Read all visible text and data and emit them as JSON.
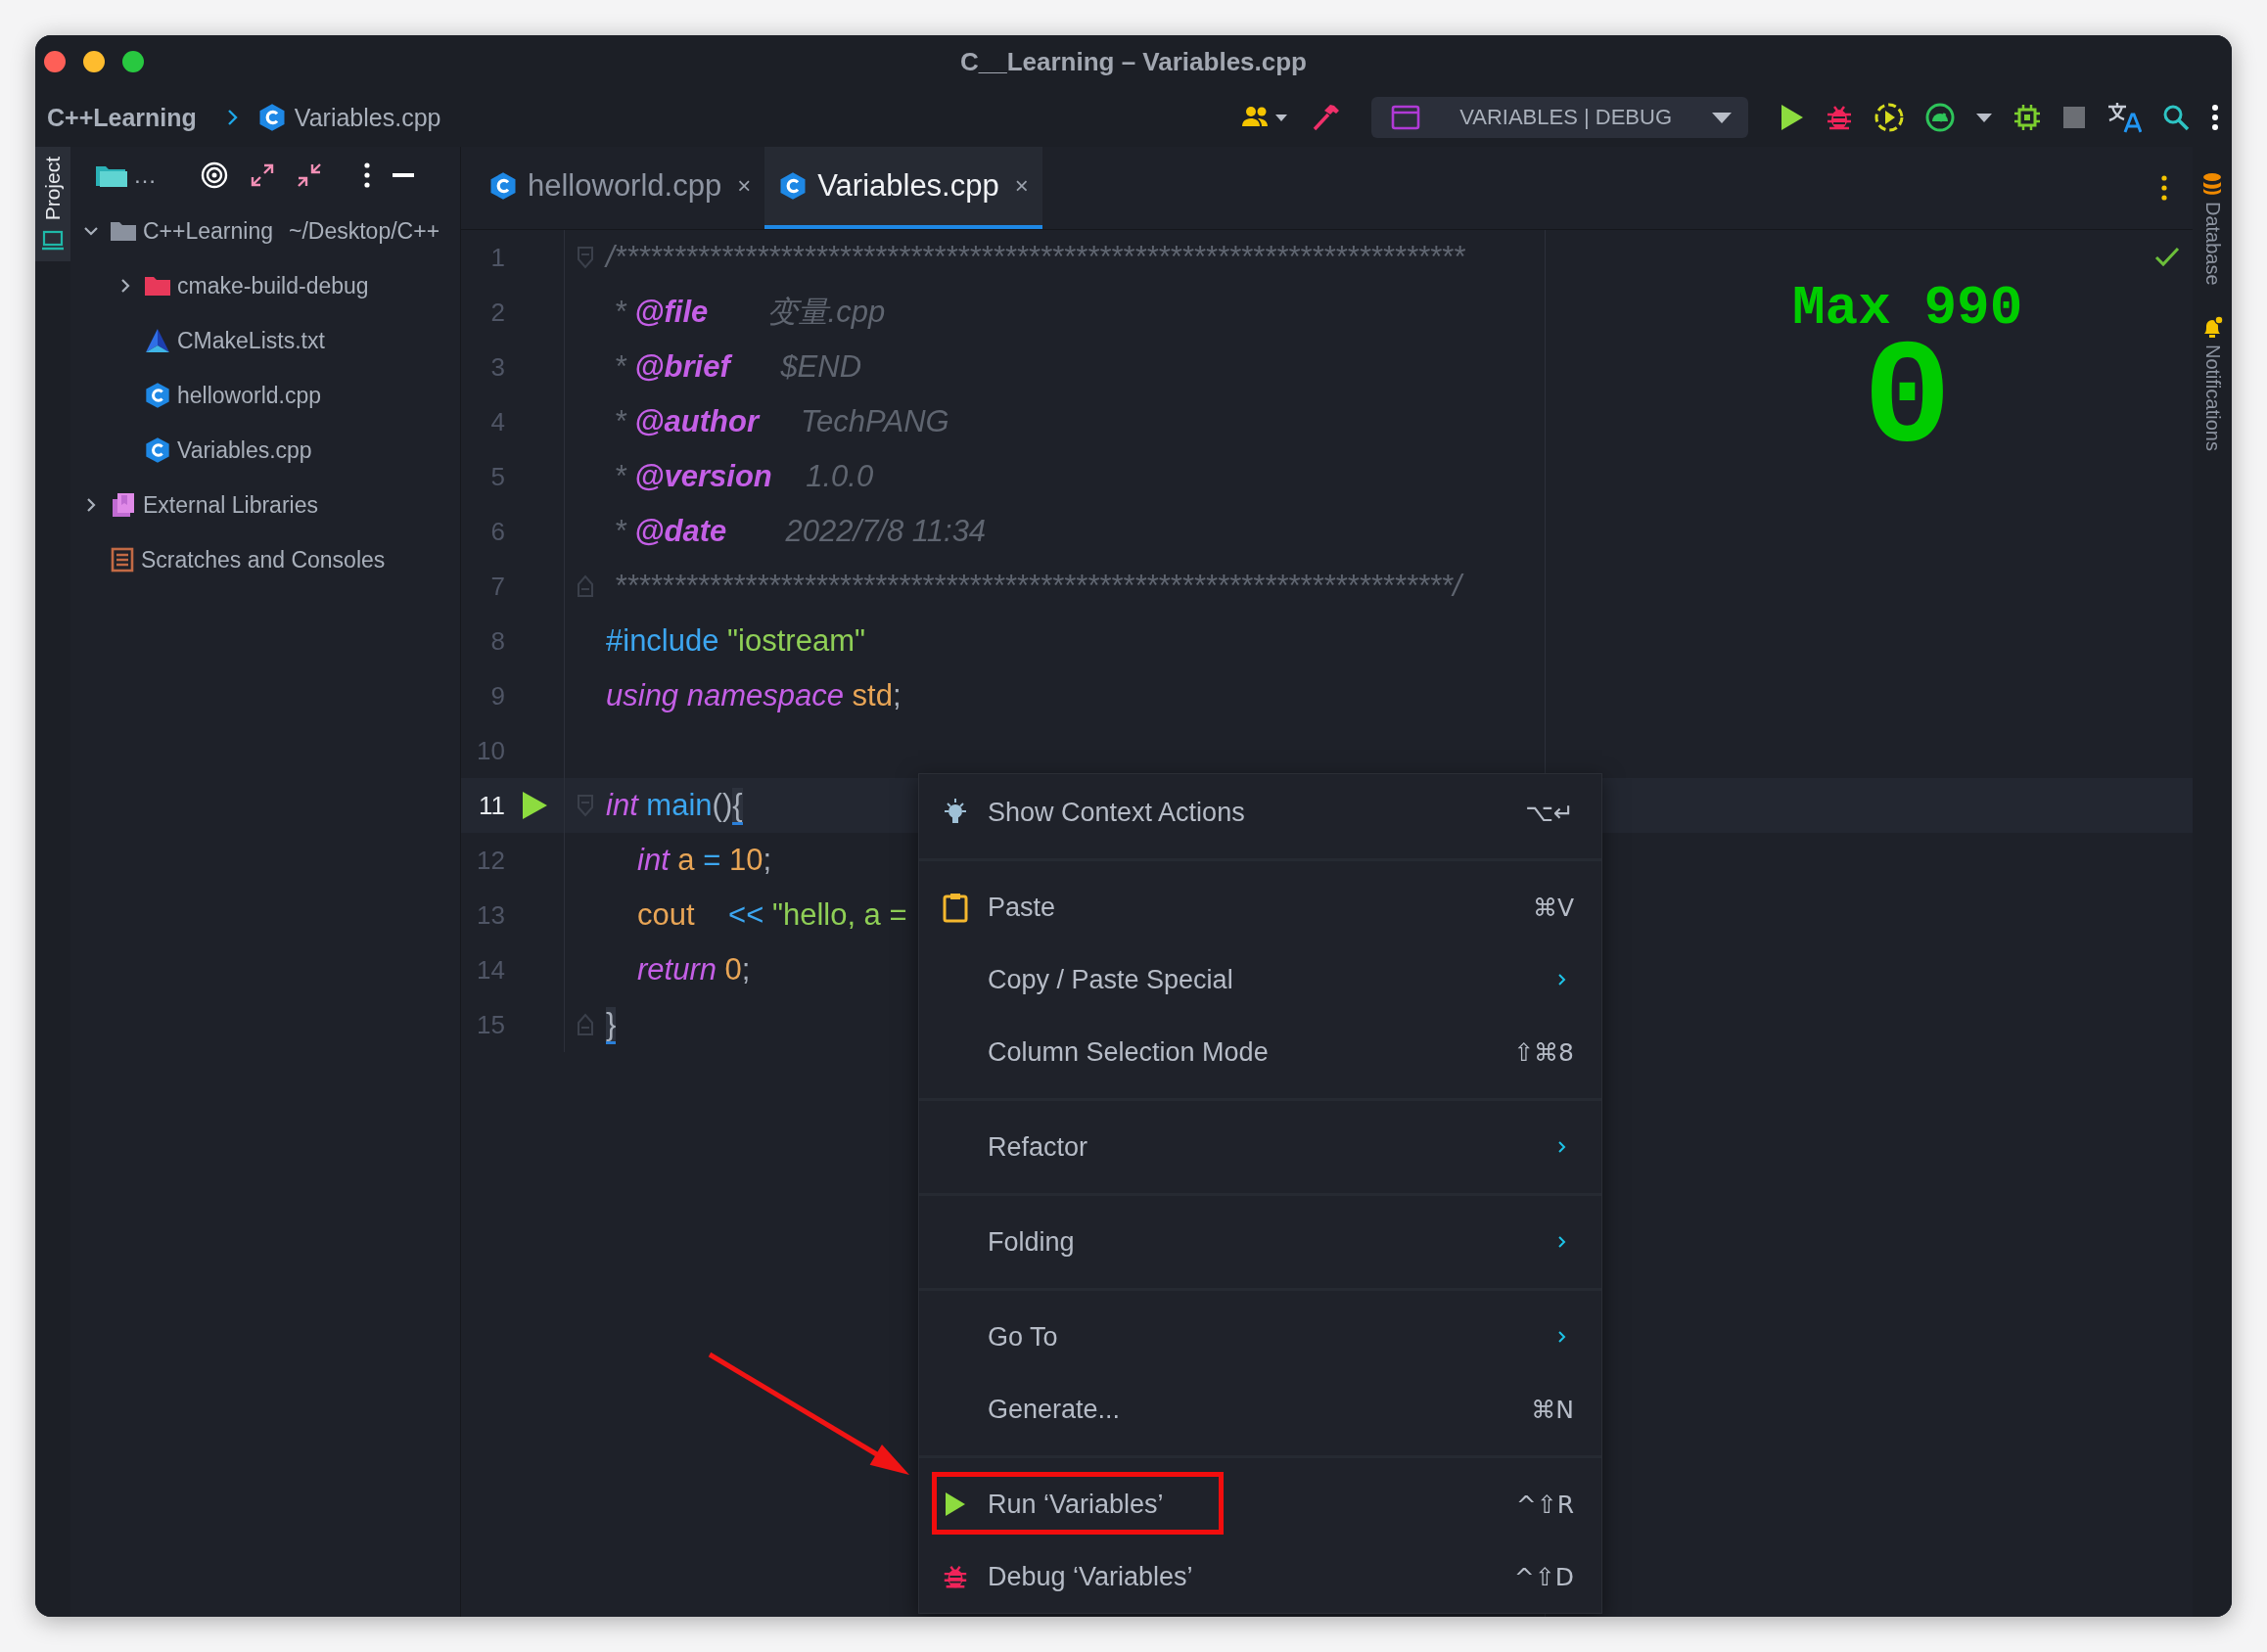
{
  "window": {
    "title": "C__Learning – Variables.cpp"
  },
  "navbar": {
    "breadcrumb": [
      {
        "label": "C++Learning",
        "kind": "project"
      },
      {
        "label": "Variables.cpp",
        "kind": "file"
      }
    ],
    "run_config": "VARIABLES | DEBUG"
  },
  "tool_windows": {
    "left": [
      {
        "label": "Project",
        "selected": true
      }
    ],
    "right": [
      {
        "label": "Database",
        "kind": "database"
      },
      {
        "label": "Notifications",
        "kind": "notifications"
      }
    ]
  },
  "project_panel": {
    "title": "…",
    "tree": [
      {
        "label": "C++Learning",
        "path": "~/Desktop/C++",
        "kind": "project-folder",
        "expanded": true,
        "children": [
          {
            "label": "cmake-build-debug",
            "kind": "excluded-folder",
            "expanded": false
          },
          {
            "label": "CMakeLists.txt",
            "kind": "cmake"
          },
          {
            "label": "helloworld.cpp",
            "kind": "cpp"
          },
          {
            "label": "Variables.cpp",
            "kind": "cpp"
          }
        ]
      },
      {
        "label": "External Libraries",
        "kind": "libraries",
        "expanded": false
      },
      {
        "label": "Scratches and Consoles",
        "kind": "scratches"
      }
    ]
  },
  "editor": {
    "tabs": [
      {
        "label": "helloworld.cpp",
        "close": "×",
        "selected": false
      },
      {
        "label": "Variables.cpp",
        "close": "×",
        "selected": true
      }
    ],
    "lines": [
      {
        "number": "1",
        "kind": "fold_start",
        "current": false,
        "run_marker": false,
        "indented": false,
        "tokens": [
          {
            "text": "/************************************************************************",
            "kind": "comment"
          }
        ]
      },
      {
        "number": "2",
        "kind": "plain",
        "current": false,
        "run_marker": false,
        "indented": false,
        "tokens": [
          {
            "text": " * ",
            "kind": "comment"
          },
          {
            "text": "@file",
            "kind": "tag"
          },
          {
            "text": "       变量.cpp",
            "kind": "doc"
          }
        ]
      },
      {
        "number": "3",
        "kind": "plain",
        "current": false,
        "run_marker": false,
        "indented": false,
        "tokens": [
          {
            "text": " * ",
            "kind": "comment"
          },
          {
            "text": "@brief",
            "kind": "tag"
          },
          {
            "text": "      $END",
            "kind": "doc"
          }
        ]
      },
      {
        "number": "4",
        "kind": "plain",
        "current": false,
        "run_marker": false,
        "indented": false,
        "tokens": [
          {
            "text": " * ",
            "kind": "comment"
          },
          {
            "text": "@author",
            "kind": "tag"
          },
          {
            "text": "     TechPANG",
            "kind": "doc"
          }
        ]
      },
      {
        "number": "5",
        "kind": "plain",
        "current": false,
        "run_marker": false,
        "indented": false,
        "tokens": [
          {
            "text": " * ",
            "kind": "comment"
          },
          {
            "text": "@version",
            "kind": "tag"
          },
          {
            "text": "    1.0.0",
            "kind": "doc"
          }
        ]
      },
      {
        "number": "6",
        "kind": "plain",
        "current": false,
        "run_marker": false,
        "indented": false,
        "tokens": [
          {
            "text": " * ",
            "kind": "comment"
          },
          {
            "text": "@date",
            "kind": "tag"
          },
          {
            "text": "       2022/7/8 11:34",
            "kind": "doc"
          }
        ]
      },
      {
        "number": "7",
        "kind": "fold_end",
        "current": false,
        "run_marker": false,
        "indented": false,
        "tokens": [
          {
            "text": " ***********************************************************************/",
            "kind": "comment"
          }
        ]
      },
      {
        "number": "8",
        "kind": "plain",
        "current": false,
        "run_marker": false,
        "indented": false,
        "tokens": [
          {
            "text": "#include",
            "kind": "directive"
          },
          {
            "text": " \"iostream\"",
            "kind": "string"
          }
        ]
      },
      {
        "number": "9",
        "kind": "plain",
        "current": false,
        "run_marker": false,
        "indented": false,
        "tokens": [
          {
            "text": "using namespace",
            "kind": "keyword"
          },
          {
            "text": " std",
            "kind": "ident"
          },
          {
            "text": ";",
            "kind": "plain"
          }
        ]
      },
      {
        "number": "10",
        "kind": "plain",
        "current": false,
        "run_marker": false
      },
      {
        "number": "11",
        "kind": "fold_start",
        "current": true,
        "run_marker": true,
        "indented": false,
        "tokens": [
          {
            "text": "int",
            "kind": "keyword"
          },
          {
            "text": " main",
            "kind": "func"
          },
          {
            "text": "()",
            "kind": "plain"
          },
          {
            "text": "{",
            "kind": "brace"
          }
        ]
      },
      {
        "number": "12",
        "kind": "plain",
        "current": false,
        "run_marker": false,
        "indented": true,
        "tokens": [
          {
            "text": "int",
            "kind": "keyword"
          },
          {
            "text": " a",
            "kind": "ident"
          },
          {
            "text": " =",
            "kind": "op"
          },
          {
            "text": " 10",
            "kind": "number"
          },
          {
            "text": ";",
            "kind": "plain"
          }
        ]
      },
      {
        "number": "13",
        "kind": "plain",
        "current": false,
        "run_marker": false,
        "indented": true,
        "tokens": [
          {
            "text": "cout",
            "kind": "ident"
          },
          {
            "text": "    <<",
            "kind": "op"
          },
          {
            "text": " \"hello, a =",
            "kind": "string"
          }
        ]
      },
      {
        "number": "14",
        "kind": "plain",
        "current": false,
        "run_marker": false,
        "indented": true,
        "tokens": [
          {
            "text": "return",
            "kind": "keyword"
          },
          {
            "text": " 0",
            "kind": "number"
          },
          {
            "text": ";",
            "kind": "plain"
          }
        ]
      },
      {
        "number": "15",
        "kind": "fold_end",
        "current": false,
        "run_marker": false,
        "indented": false,
        "tokens": [
          {
            "text": "}",
            "kind": "brace"
          }
        ]
      }
    ],
    "power_mode": {
      "max": "Max 990",
      "combo": "0"
    }
  },
  "context_menu": {
    "groups": [
      [
        {
          "label": "Show Context Actions",
          "kind": "bulb",
          "shortcut": "⌥↵",
          "submenu": false,
          "annotated": false
        }
      ],
      [
        {
          "label": "Paste",
          "kind": "clipboard",
          "shortcut": "⌘V",
          "submenu": false,
          "annotated": false
        },
        {
          "label": "Copy / Paste Special",
          "kind": "plain",
          "submenu": true,
          "annotated": false
        },
        {
          "label": "Column Selection Mode",
          "kind": "plain",
          "shortcut": "⇧⌘8",
          "submenu": false,
          "annotated": false
        }
      ],
      [
        {
          "label": "Refactor",
          "kind": "plain",
          "submenu": true,
          "annotated": false
        }
      ],
      [
        {
          "label": "Folding",
          "kind": "plain",
          "submenu": true,
          "annotated": false
        }
      ],
      [
        {
          "label": "Go To",
          "kind": "plain",
          "submenu": true,
          "annotated": false
        },
        {
          "label": "Generate...",
          "kind": "plain",
          "shortcut": "⌘N",
          "submenu": false,
          "annotated": false
        }
      ],
      [
        {
          "label": "Run ‘Variables’",
          "kind": "run",
          "shortcut": "^⇧R",
          "submenu": false,
          "annotated": true
        },
        {
          "label": "Debug ‘Variables’",
          "kind": "debug",
          "shortcut": "^⇧D",
          "submenu": false,
          "annotated": false
        }
      ]
    ]
  }
}
